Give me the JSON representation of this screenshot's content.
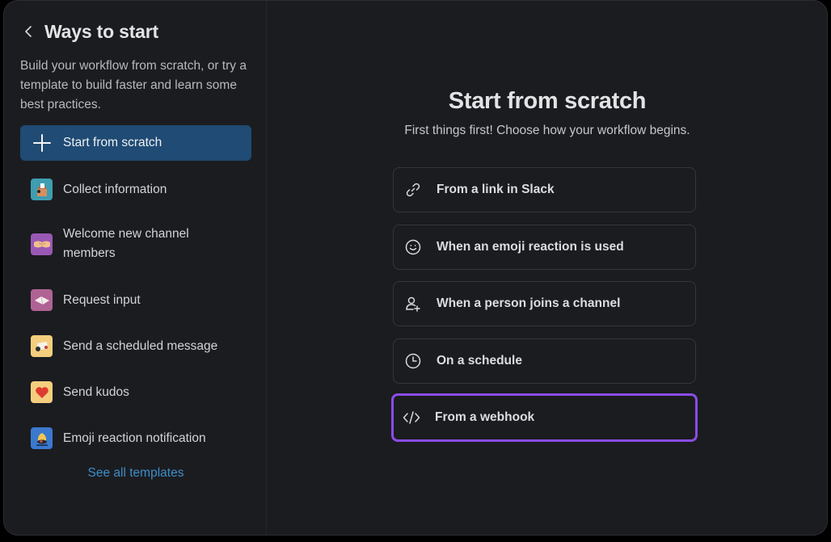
{
  "sidebar": {
    "title": "Ways to start",
    "description": "Build your workflow from scratch, or try a template to build faster and learn some best practices.",
    "items": [
      {
        "label": "Start from scratch",
        "icon": "plus-icon",
        "selected": true
      },
      {
        "label": "Collect information",
        "icon": "ballot-box-icon"
      },
      {
        "label": "Welcome new channel members",
        "icon": "handshake-icon"
      },
      {
        "label": "Request input",
        "icon": "open-book-icon"
      },
      {
        "label": "Send a scheduled message",
        "icon": "scroll-icon"
      },
      {
        "label": "Send kudos",
        "icon": "heart-icon"
      },
      {
        "label": "Emoji reaction notification",
        "icon": "bell-icon"
      }
    ],
    "see_all": "See all templates"
  },
  "main": {
    "title": "Start from scratch",
    "subtitle": "First things first! Choose how your workflow begins.",
    "options": [
      {
        "label": "From a link in Slack",
        "icon": "link-icon"
      },
      {
        "label": "When an emoji reaction is used",
        "icon": "smiley-icon"
      },
      {
        "label": "When a person joins a channel",
        "icon": "person-add-icon"
      },
      {
        "label": "On a schedule",
        "icon": "clock-icon"
      },
      {
        "label": "From a webhook",
        "icon": "code-icon",
        "focused": true
      }
    ]
  },
  "colors": {
    "background": "#1b1c20",
    "selected": "#1f4b74",
    "focus_ring": "#8b4ce8",
    "link": "#3d8ec9"
  }
}
